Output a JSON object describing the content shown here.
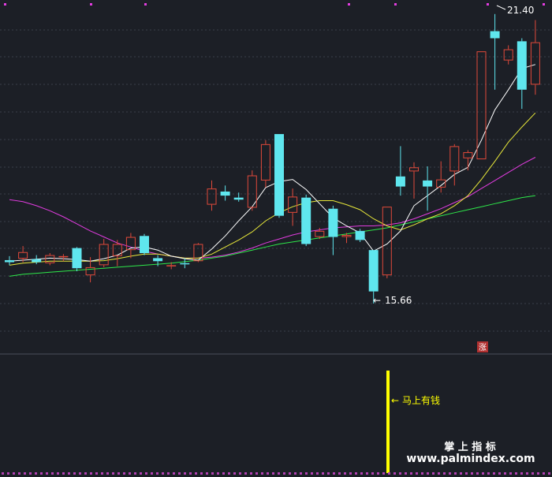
{
  "colors": {
    "background": "#1c1f26",
    "grid": "#3a3f4a",
    "up_candle": "#e0493a",
    "down_candle": "#5fe6ee",
    "ma5": "#ffffff",
    "ma10": "#e8e83a",
    "ma20": "#e23ce0",
    "ma60": "#2ee84a",
    "signal": "#ffff00",
    "annotation": "#ffffff",
    "watermark": "#ffffff",
    "badge": "#b03030"
  },
  "annotations": {
    "high_label": "21.40",
    "low_label": "15.66",
    "signal_label": "马上有钱",
    "badge": "涨"
  },
  "watermark": {
    "line1": "掌 上 指 标",
    "line2": "www.palmindex.com"
  },
  "chart_data": {
    "type": "candlestick",
    "ylim": [
      14.8,
      21.6
    ],
    "grid": true,
    "candles": [
      {
        "o": 16.52,
        "h": 16.6,
        "l": 16.42,
        "c": 16.48,
        "dir": "down"
      },
      {
        "o": 16.55,
        "h": 16.8,
        "l": 16.48,
        "c": 16.68,
        "dir": "up"
      },
      {
        "o": 16.54,
        "h": 16.62,
        "l": 16.44,
        "c": 16.48,
        "dir": "down"
      },
      {
        "o": 16.46,
        "h": 16.66,
        "l": 16.42,
        "c": 16.62,
        "dir": "up"
      },
      {
        "o": 16.58,
        "h": 16.64,
        "l": 16.5,
        "c": 16.6,
        "dir": "up"
      },
      {
        "o": 16.76,
        "h": 16.78,
        "l": 16.3,
        "c": 16.36,
        "dir": "down"
      },
      {
        "o": 16.22,
        "h": 16.58,
        "l": 16.08,
        "c": 16.38,
        "dir": "up"
      },
      {
        "o": 16.42,
        "h": 16.94,
        "l": 16.38,
        "c": 16.84,
        "dir": "up"
      },
      {
        "o": 16.6,
        "h": 16.92,
        "l": 16.4,
        "c": 16.84,
        "dir": "up"
      },
      {
        "o": 16.72,
        "h": 17.06,
        "l": 16.56,
        "c": 16.98,
        "dir": "up"
      },
      {
        "o": 17.0,
        "h": 17.04,
        "l": 16.62,
        "c": 16.66,
        "dir": "down"
      },
      {
        "o": 16.56,
        "h": 16.62,
        "l": 16.4,
        "c": 16.5,
        "dir": "down"
      },
      {
        "o": 16.4,
        "h": 16.48,
        "l": 16.34,
        "c": 16.42,
        "dir": "up"
      },
      {
        "o": 16.44,
        "h": 16.56,
        "l": 16.36,
        "c": 16.46,
        "dir": "down"
      },
      {
        "o": 16.5,
        "h": 16.86,
        "l": 16.48,
        "c": 16.84,
        "dir": "up"
      },
      {
        "o": 17.62,
        "h": 18.1,
        "l": 17.5,
        "c": 17.94,
        "dir": "up"
      },
      {
        "o": 17.88,
        "h": 18.0,
        "l": 17.7,
        "c": 17.8,
        "dir": "down"
      },
      {
        "o": 17.76,
        "h": 17.86,
        "l": 17.68,
        "c": 17.72,
        "dir": "down"
      },
      {
        "o": 17.56,
        "h": 18.3,
        "l": 17.5,
        "c": 18.2,
        "dir": "up"
      },
      {
        "o": 18.1,
        "h": 18.9,
        "l": 17.96,
        "c": 18.82,
        "dir": "up"
      },
      {
        "o": 19.02,
        "h": 19.02,
        "l": 17.36,
        "c": 17.4,
        "dir": "down"
      },
      {
        "o": 17.46,
        "h": 17.94,
        "l": 17.2,
        "c": 17.78,
        "dir": "up"
      },
      {
        "o": 17.76,
        "h": 17.82,
        "l": 16.8,
        "c": 16.84,
        "dir": "down"
      },
      {
        "o": 16.98,
        "h": 17.16,
        "l": 16.94,
        "c": 17.1,
        "dir": "up"
      },
      {
        "o": 17.54,
        "h": 17.6,
        "l": 16.62,
        "c": 16.98,
        "dir": "down"
      },
      {
        "o": 16.98,
        "h": 17.06,
        "l": 16.86,
        "c": 17.02,
        "dir": "up"
      },
      {
        "o": 17.1,
        "h": 17.14,
        "l": 16.88,
        "c": 16.92,
        "dir": "down"
      },
      {
        "o": 16.72,
        "h": 16.72,
        "l": 15.66,
        "c": 15.9,
        "dir": "down"
      },
      {
        "o": 16.22,
        "h": 17.58,
        "l": 16.16,
        "c": 17.58,
        "dir": "up"
      },
      {
        "o": 18.18,
        "h": 18.78,
        "l": 17.8,
        "c": 17.98,
        "dir": "down"
      },
      {
        "o": 18.36,
        "h": 18.46,
        "l": 17.74,
        "c": 18.28,
        "dir": "up"
      },
      {
        "o": 18.1,
        "h": 18.38,
        "l": 17.5,
        "c": 17.98,
        "dir": "down"
      },
      {
        "o": 17.96,
        "h": 18.48,
        "l": 17.86,
        "c": 18.12,
        "dir": "up"
      },
      {
        "o": 18.28,
        "h": 18.82,
        "l": 18.0,
        "c": 18.78,
        "dir": "up"
      },
      {
        "o": 18.54,
        "h": 18.7,
        "l": 18.3,
        "c": 18.66,
        "dir": "up"
      },
      {
        "o": 18.52,
        "h": 20.66,
        "l": 18.52,
        "c": 20.66,
        "dir": "up"
      },
      {
        "o": 21.06,
        "h": 21.4,
        "l": 19.9,
        "c": 20.92,
        "dir": "down"
      },
      {
        "o": 20.48,
        "h": 20.78,
        "l": 20.4,
        "c": 20.7,
        "dir": "up"
      },
      {
        "o": 20.86,
        "h": 20.92,
        "l": 19.52,
        "c": 19.9,
        "dir": "down"
      },
      {
        "o": 20.0,
        "h": 21.28,
        "l": 19.8,
        "c": 20.84,
        "dir": "up"
      }
    ],
    "ma5": [
      16.5,
      16.52,
      16.54,
      16.56,
      16.55,
      16.53,
      16.5,
      16.55,
      16.62,
      16.76,
      16.78,
      16.72,
      16.6,
      16.55,
      16.52,
      16.74,
      17.0,
      17.3,
      17.58,
      17.96,
      18.08,
      18.12,
      17.92,
      17.64,
      17.36,
      17.2,
      17.06,
      16.7,
      16.84,
      17.1,
      17.6,
      17.8,
      18.0,
      18.22,
      18.36,
      18.9,
      19.5,
      19.9,
      20.32,
      20.4
    ],
    "ma10": [
      16.42,
      16.46,
      16.48,
      16.5,
      16.5,
      16.5,
      16.5,
      16.51,
      16.55,
      16.6,
      16.64,
      16.64,
      16.6,
      16.56,
      16.56,
      16.64,
      16.78,
      16.92,
      17.08,
      17.3,
      17.46,
      17.58,
      17.66,
      17.7,
      17.7,
      17.62,
      17.52,
      17.34,
      17.2,
      17.12,
      17.22,
      17.34,
      17.44,
      17.6,
      17.8,
      18.12,
      18.48,
      18.86,
      19.16,
      19.44
    ],
    "ma20": [
      17.72,
      17.68,
      17.6,
      17.5,
      17.38,
      17.24,
      17.1,
      16.98,
      16.86,
      16.78,
      16.7,
      16.64,
      16.6,
      16.56,
      16.56,
      16.58,
      16.62,
      16.68,
      16.76,
      16.86,
      16.94,
      17.02,
      17.08,
      17.12,
      17.16,
      17.18,
      17.2,
      17.2,
      17.22,
      17.26,
      17.34,
      17.44,
      17.54,
      17.66,
      17.78,
      17.94,
      18.1,
      18.26,
      18.42,
      18.56
    ],
    "ma60": [
      16.2,
      16.24,
      16.26,
      16.28,
      16.3,
      16.32,
      16.34,
      16.36,
      16.38,
      16.4,
      16.42,
      16.44,
      16.46,
      16.49,
      16.52,
      16.56,
      16.6,
      16.66,
      16.72,
      16.78,
      16.84,
      16.88,
      16.92,
      16.96,
      17.0,
      17.04,
      17.08,
      17.12,
      17.16,
      17.22,
      17.28,
      17.34,
      17.4,
      17.46,
      17.52,
      17.58,
      17.64,
      17.7,
      17.76,
      17.8
    ],
    "signal_index": 28
  }
}
